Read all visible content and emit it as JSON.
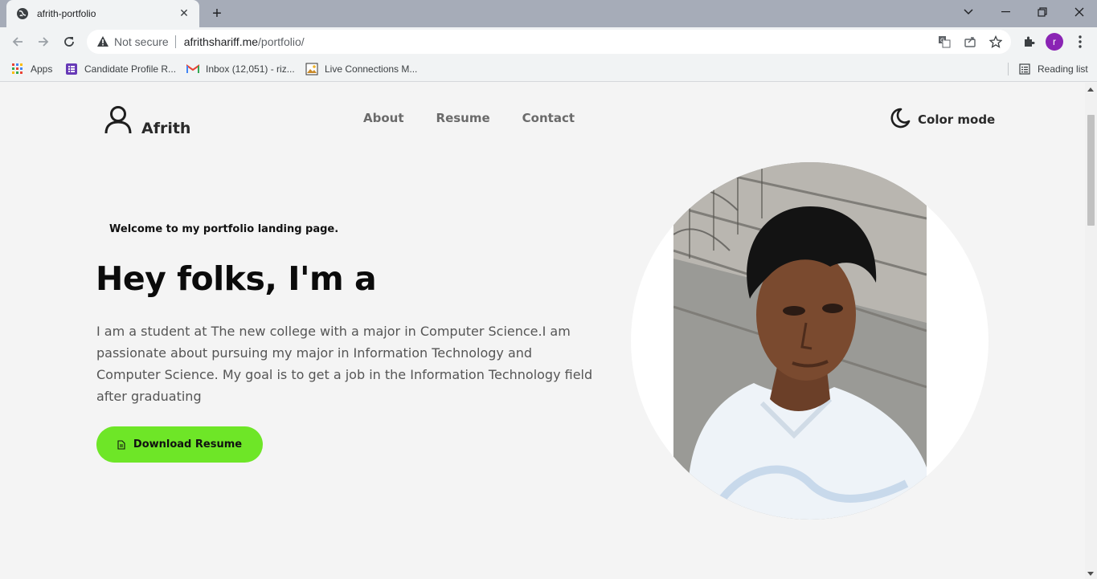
{
  "browser": {
    "tab_title": "afrith-portfolio",
    "new_tab_symbol": "+",
    "omnibox": {
      "security_label": "Not secure",
      "host": "afrithshariff.me",
      "path": "/portfolio/"
    },
    "profile_initial": "r",
    "bookmarks": [
      {
        "label": "Apps",
        "icon": "apps-grid-icon"
      },
      {
        "label": "Candidate Profile R...",
        "icon": "form-icon"
      },
      {
        "label": "Inbox (12,051) - riz...",
        "icon": "gmail-icon"
      },
      {
        "label": "Live Connections M...",
        "icon": "image-icon"
      }
    ],
    "reading_list_label": "Reading list"
  },
  "site": {
    "logo_name": "Afrith",
    "nav": [
      "About",
      "Resume",
      "Contact"
    ],
    "color_mode_label": "Color mode",
    "welcome": "Welcome to my portfolio landing page.",
    "hero_title": "Hey folks, I'm a",
    "bio_lines": [
      "I am a student at The new college with a major in Computer Science.I am",
      "passionate about pursuing my major in Information Technology and",
      "Computer Science. My goal is to get a job in the Information Technology field",
      "after graduating"
    ],
    "download_button": "Download Resume",
    "accent_color": "#6ee627"
  }
}
